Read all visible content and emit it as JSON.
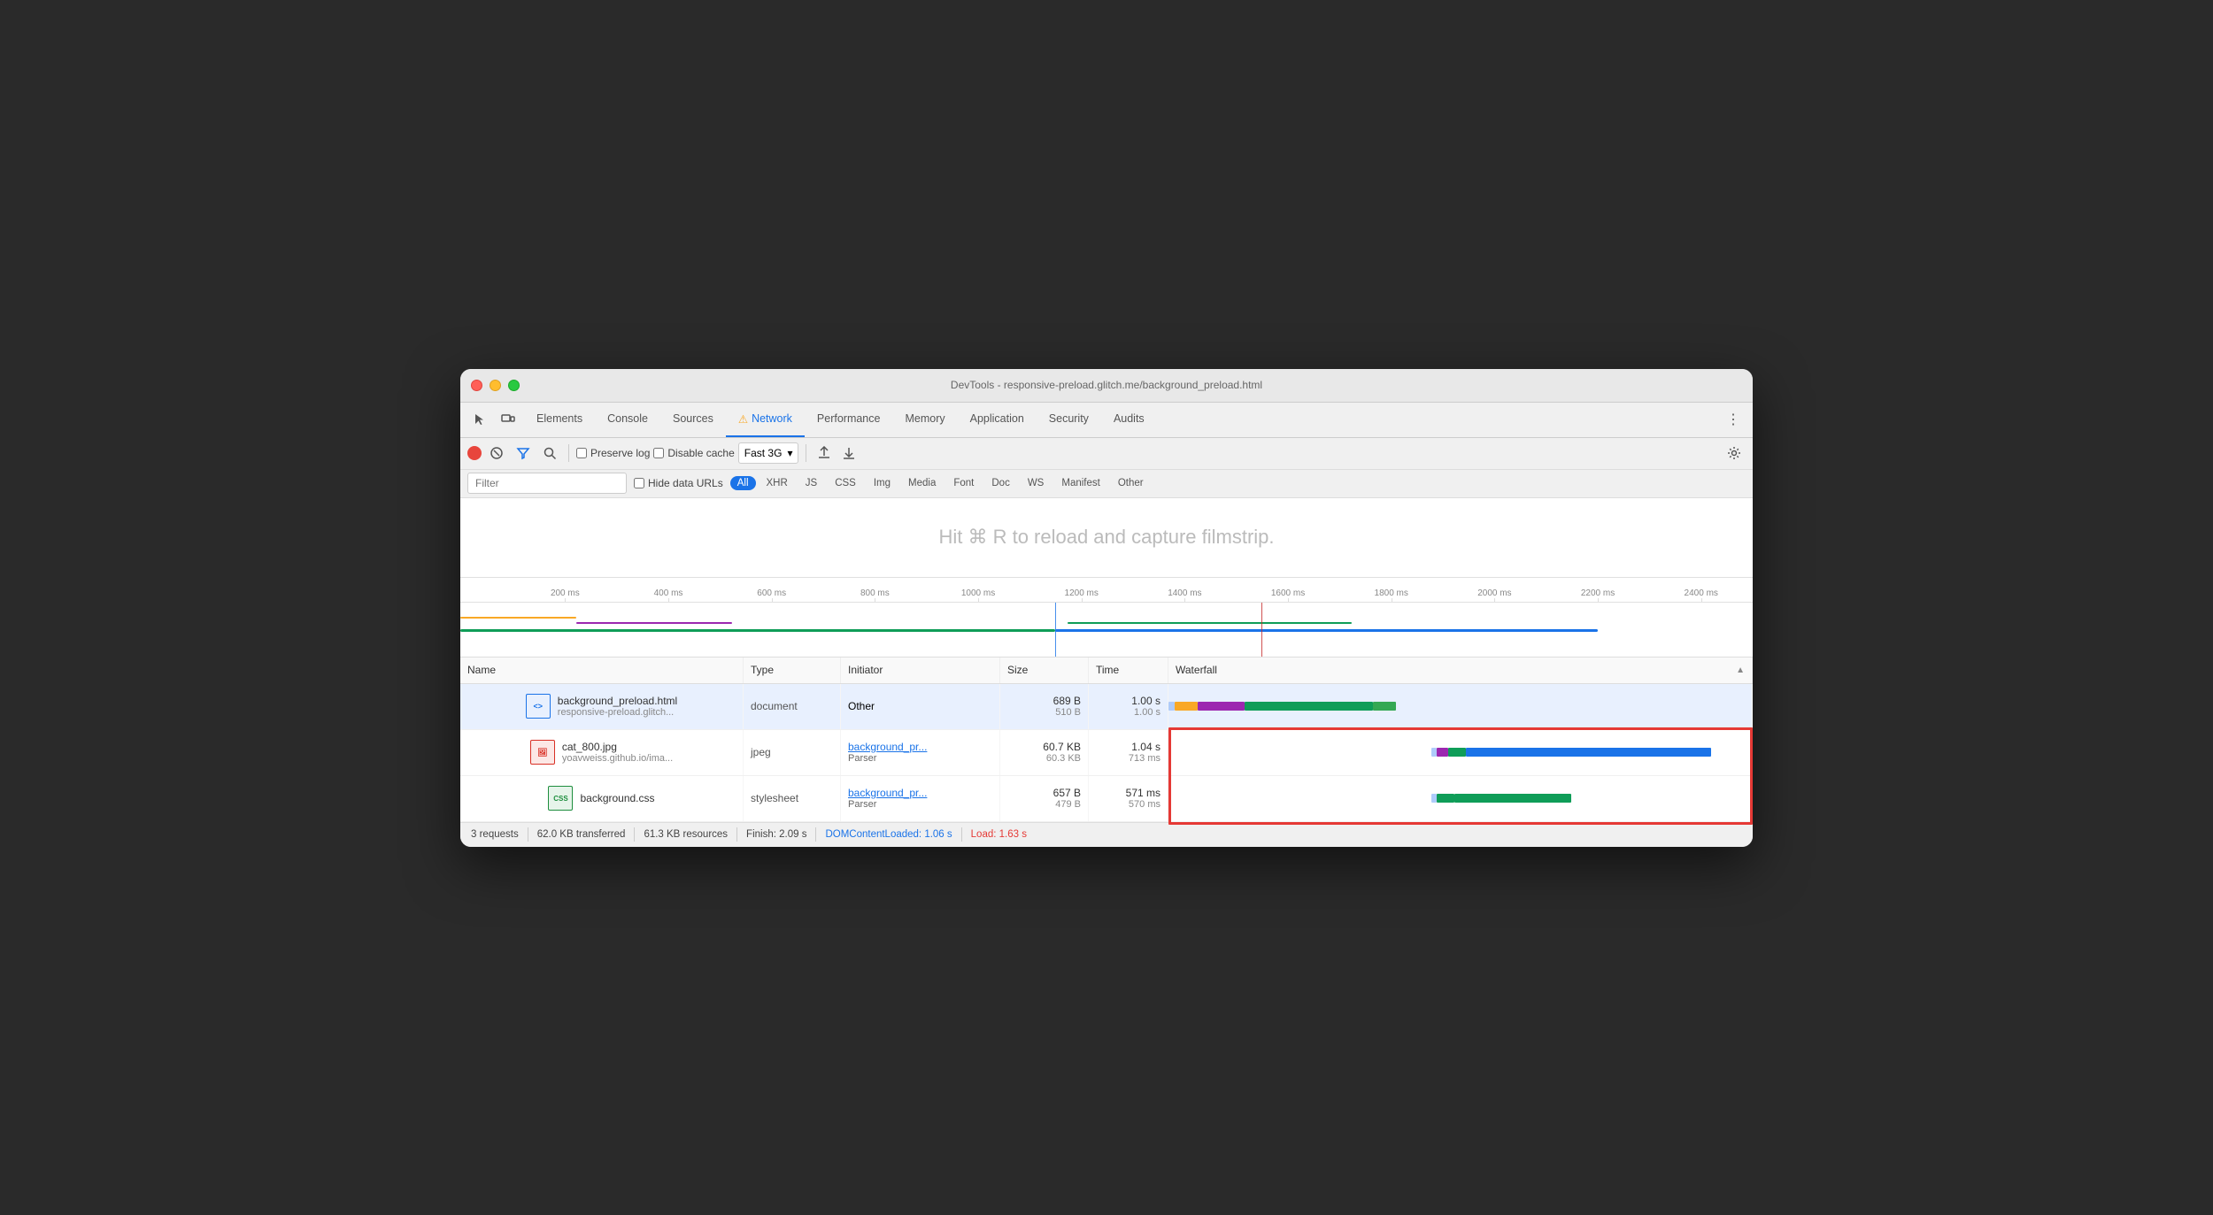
{
  "window": {
    "title": "DevTools - responsive-preload.glitch.me/background_preload.html"
  },
  "tabs": [
    {
      "id": "elements",
      "label": "Elements",
      "active": false
    },
    {
      "id": "console",
      "label": "Console",
      "active": false
    },
    {
      "id": "sources",
      "label": "Sources",
      "active": false
    },
    {
      "id": "network",
      "label": "Network",
      "active": true,
      "icon": "⚠"
    },
    {
      "id": "performance",
      "label": "Performance",
      "active": false
    },
    {
      "id": "memory",
      "label": "Memory",
      "active": false
    },
    {
      "id": "application",
      "label": "Application",
      "active": false
    },
    {
      "id": "security",
      "label": "Security",
      "active": false
    },
    {
      "id": "audits",
      "label": "Audits",
      "active": false
    }
  ],
  "toolbar": {
    "preserve_log": "Preserve log",
    "disable_cache": "Disable cache",
    "throttle": "Fast 3G"
  },
  "filter": {
    "placeholder": "Filter",
    "hide_data_urls": "Hide data URLs",
    "tags": [
      "All",
      "XHR",
      "JS",
      "CSS",
      "Img",
      "Media",
      "Font",
      "Doc",
      "WS",
      "Manifest",
      "Other"
    ]
  },
  "filmstrip": {
    "message": "Hit ⌘ R to reload and capture filmstrip."
  },
  "ruler": {
    "ticks": [
      "200 ms",
      "400 ms",
      "600 ms",
      "800 ms",
      "1000 ms",
      "1200 ms",
      "1400 ms",
      "1600 ms",
      "1800 ms",
      "2000 ms",
      "2200 ms",
      "2400 ms"
    ]
  },
  "table": {
    "headers": [
      "Name",
      "Type",
      "Initiator",
      "Size",
      "Time",
      "Waterfall"
    ],
    "rows": [
      {
        "name": "background_preload.html",
        "url": "responsive-preload.glitch...",
        "type": "document",
        "initiator": "Other",
        "initiator_link": false,
        "size": "689 B",
        "size_sub": "510 B",
        "time": "1.00 s",
        "time_sub": "1.00 s",
        "icon_type": "html",
        "icon_label": "<>"
      },
      {
        "name": "cat_800.jpg",
        "url": "yoavweiss.github.io/ima...",
        "type": "jpeg",
        "initiator": "background_pr...",
        "initiator_sub": "Parser",
        "initiator_link": true,
        "size": "60.7 KB",
        "size_sub": "60.3 KB",
        "time": "1.04 s",
        "time_sub": "713 ms",
        "icon_type": "img",
        "icon_label": "IMG"
      },
      {
        "name": "background.css",
        "url": "",
        "type": "stylesheet",
        "initiator": "background_pr...",
        "initiator_sub": "Parser",
        "initiator_link": true,
        "size": "657 B",
        "size_sub": "479 B",
        "time": "571 ms",
        "time_sub": "570 ms",
        "icon_type": "css",
        "icon_label": "CSS"
      }
    ]
  },
  "status": {
    "requests": "3 requests",
    "transferred": "62.0 KB transferred",
    "resources": "61.3 KB resources",
    "finish": "Finish: 2.09 s",
    "dom_content_loaded": "DOMContentLoaded: 1.06 s",
    "load": "Load: 1.63 s"
  }
}
